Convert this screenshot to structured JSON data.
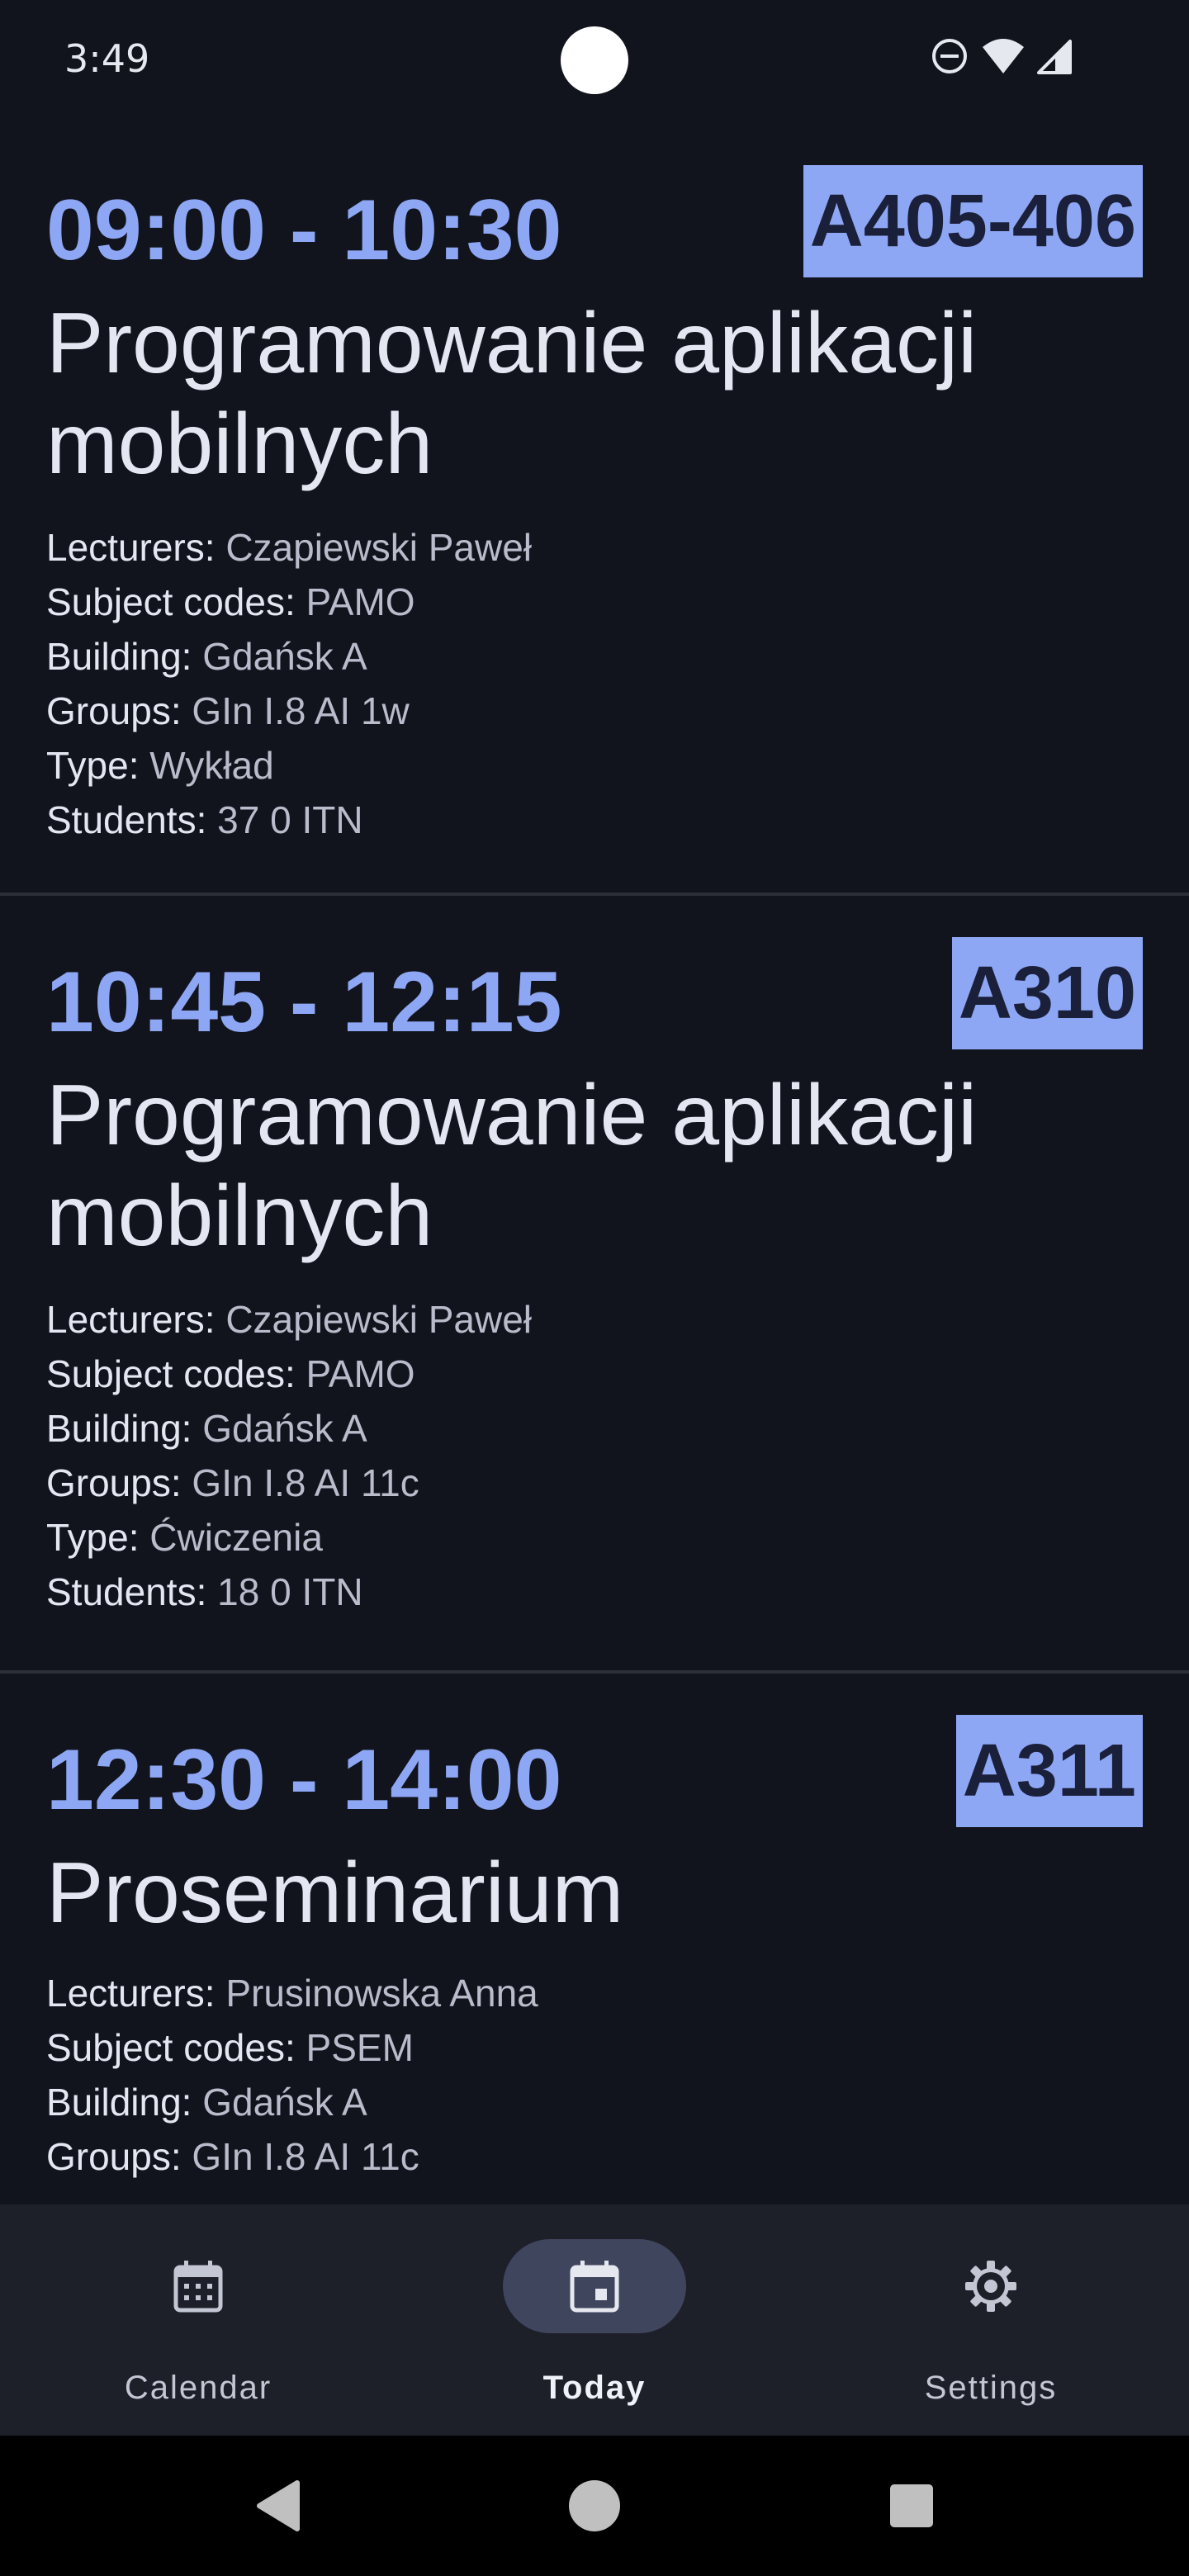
{
  "status_bar": {
    "time": "3:49",
    "icons": [
      "do-not-disturb-icon",
      "wifi-icon",
      "cell-signal-icon"
    ]
  },
  "classes": [
    {
      "time": "09:00 - 10:30",
      "room": "A405-406",
      "subject": "Programowanie aplikacji mobilnych",
      "details": [
        {
          "key": "Lecturers:",
          "value": "Czapiewski Paweł"
        },
        {
          "key": "Subject codes:",
          "value": "PAMO"
        },
        {
          "key": "Building:",
          "value": "Gdańsk A"
        },
        {
          "key": "Groups:",
          "value": "GIn I.8 AI 1w"
        },
        {
          "key": "Type:",
          "value": "Wykład"
        },
        {
          "key": "Students:",
          "value": "37 0 ITN"
        }
      ]
    },
    {
      "time": "10:45 - 12:15",
      "room": "A310",
      "subject": "Programowanie aplikacji mobilnych",
      "details": [
        {
          "key": "Lecturers:",
          "value": "Czapiewski Paweł"
        },
        {
          "key": "Subject codes:",
          "value": "PAMO"
        },
        {
          "key": "Building:",
          "value": "Gdańsk A"
        },
        {
          "key": "Groups:",
          "value": "GIn I.8 AI 11c"
        },
        {
          "key": "Type:",
          "value": "Ćwiczenia"
        },
        {
          "key": "Students:",
          "value": "18 0 ITN"
        }
      ]
    },
    {
      "time": "12:30 - 14:00",
      "room": "A311",
      "subject": "Proseminarium",
      "details": [
        {
          "key": "Lecturers:",
          "value": "Prusinowska Anna"
        },
        {
          "key": "Subject codes:",
          "value": "PSEM"
        },
        {
          "key": "Building:",
          "value": "Gdańsk A"
        },
        {
          "key": "Groups:",
          "value": "GIn I.8 AI 11c"
        }
      ]
    }
  ],
  "bottom_nav": {
    "items": [
      {
        "label": "Calendar",
        "icon": "calendar-icon",
        "active": false
      },
      {
        "label": "Today",
        "icon": "today-icon",
        "active": true
      },
      {
        "label": "Settings",
        "icon": "gear-icon",
        "active": false
      }
    ]
  },
  "colors": {
    "background": "#12141d",
    "accent": "#8ea7f5",
    "nav_background": "#1d1f29",
    "nav_active_pill": "#40455e"
  }
}
